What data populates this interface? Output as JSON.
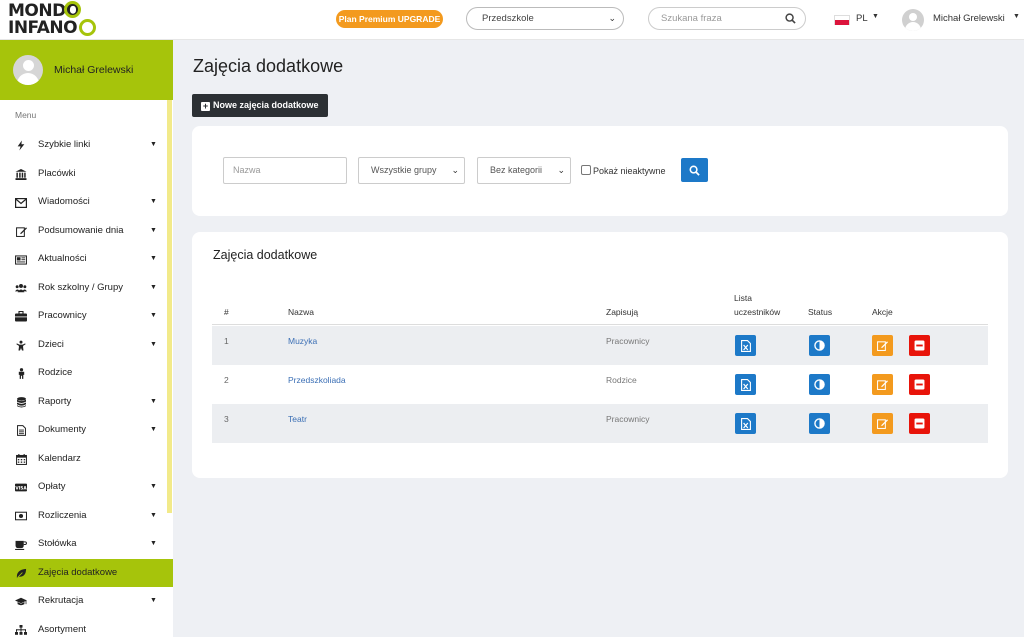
{
  "header": {
    "logo_line1": "MONDO",
    "logo_line2": "INFANO",
    "premium_label": "Plan Premium UPGRADE",
    "location_select": "Przedszkole",
    "search_placeholder": "Szukana fraza",
    "language": "PL",
    "user_name": "Michał Grelewski"
  },
  "sidebar": {
    "user_name": "Michał Grelewski",
    "menu_label": "Menu",
    "items": [
      {
        "label": "Szybkie linki",
        "icon": "bolt-icon",
        "dropdown": true,
        "active": false
      },
      {
        "label": "Placówki",
        "icon": "institution-icon",
        "dropdown": false,
        "active": false
      },
      {
        "label": "Wiadomości",
        "icon": "envelope-icon",
        "dropdown": true,
        "active": false
      },
      {
        "label": "Podsumowanie dnia",
        "icon": "edit-icon",
        "dropdown": true,
        "active": false
      },
      {
        "label": "Aktualności",
        "icon": "newspaper-icon",
        "dropdown": true,
        "active": false
      },
      {
        "label": "Rok szkolny / Grupy",
        "icon": "users-icon",
        "dropdown": true,
        "active": false
      },
      {
        "label": "Pracownicy",
        "icon": "briefcase-icon",
        "dropdown": true,
        "active": false
      },
      {
        "label": "Dzieci",
        "icon": "child-icon",
        "dropdown": true,
        "active": false
      },
      {
        "label": "Rodzice",
        "icon": "person-icon",
        "dropdown": false,
        "active": false
      },
      {
        "label": "Raporty",
        "icon": "database-icon",
        "dropdown": true,
        "active": false
      },
      {
        "label": "Dokumenty",
        "icon": "document-icon",
        "dropdown": true,
        "active": false
      },
      {
        "label": "Kalendarz",
        "icon": "calendar-icon",
        "dropdown": false,
        "active": false
      },
      {
        "label": "Opłaty",
        "icon": "visa-card-icon",
        "dropdown": true,
        "active": false
      },
      {
        "label": "Rozliczenia",
        "icon": "money-icon",
        "dropdown": true,
        "active": false
      },
      {
        "label": "Stołówka",
        "icon": "coffee-icon",
        "dropdown": true,
        "active": false
      },
      {
        "label": "Zajęcia dodatkowe",
        "icon": "leaf-icon",
        "dropdown": false,
        "active": true
      },
      {
        "label": "Rekrutacja",
        "icon": "graduation-cap-icon",
        "dropdown": true,
        "active": false
      },
      {
        "label": "Asortyment",
        "icon": "sitemap-icon",
        "dropdown": false,
        "active": false
      }
    ]
  },
  "main": {
    "page_title": "Zajęcia dodatkowe",
    "new_button": "Nowe zajęcia dodatkowe",
    "filters": {
      "name_placeholder": "Nazwa",
      "group_select": "Wszystkie grupy",
      "category_select": "Bez kategorii",
      "inactive_label": "Pokaż nieaktywne"
    },
    "table": {
      "title": "Zajęcia dodatkowe",
      "headers": {
        "num": "#",
        "name": "Nazwa",
        "enroll": "Zapisują",
        "list_line1": "Lista",
        "list_line2": "uczestników",
        "status": "Status",
        "actions": "Akcje"
      },
      "rows": [
        {
          "num": "1",
          "name": "Muzyka",
          "enroll": "Pracownicy"
        },
        {
          "num": "2",
          "name": "Przedszkoliada",
          "enroll": "Rodzice"
        },
        {
          "num": "3",
          "name": "Teatr",
          "enroll": "Pracownicy"
        }
      ]
    }
  },
  "colors": {
    "brand_green": "#a6c40b",
    "premium_orange": "#f39a1e",
    "primary_blue": "#1d79c8",
    "danger_red": "#e8140a",
    "dark_button": "#2c3034"
  }
}
